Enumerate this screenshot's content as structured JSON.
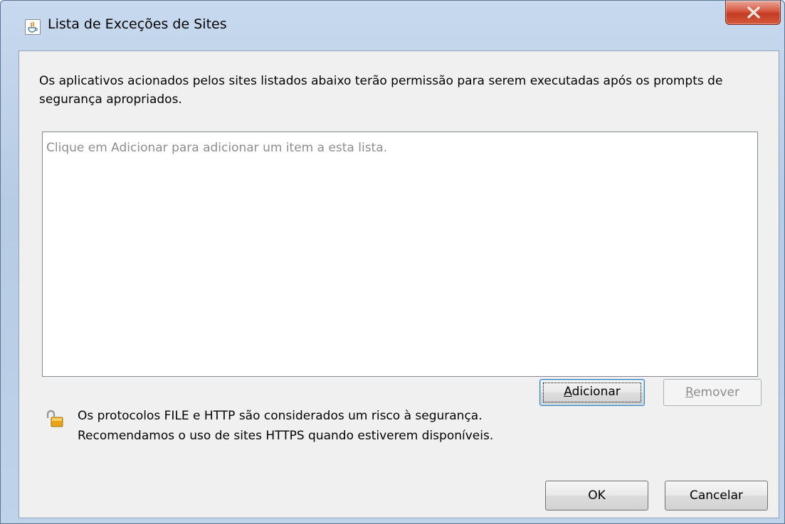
{
  "window": {
    "title": "Lista de Exceções de Sites",
    "title_icon": "java-icon",
    "close_icon": "close-icon",
    "accent_close": "#c43a22"
  },
  "description": "Os aplicativos acionados pelos sites listados abaixo terão permissão para serem executadas após os prompts de segurança apropriados.",
  "list": {
    "placeholder": "Clique em Adicionar para adicionar um item a esta lista.",
    "items": []
  },
  "buttons": {
    "add": {
      "mnemonic": "A",
      "rest": "dicionar",
      "enabled": true,
      "focused": true
    },
    "remove": {
      "mnemonic": "R",
      "rest": "emover",
      "enabled": false
    },
    "ok": "OK",
    "cancel": "Cancelar"
  },
  "warning": {
    "icon": "unlocked-padlock-icon",
    "line1": "Os protocolos FILE e HTTP são considerados um risco à segurança.",
    "line2": "Recomendamos o uso de sites HTTPS quando estiverem disponíveis."
  }
}
